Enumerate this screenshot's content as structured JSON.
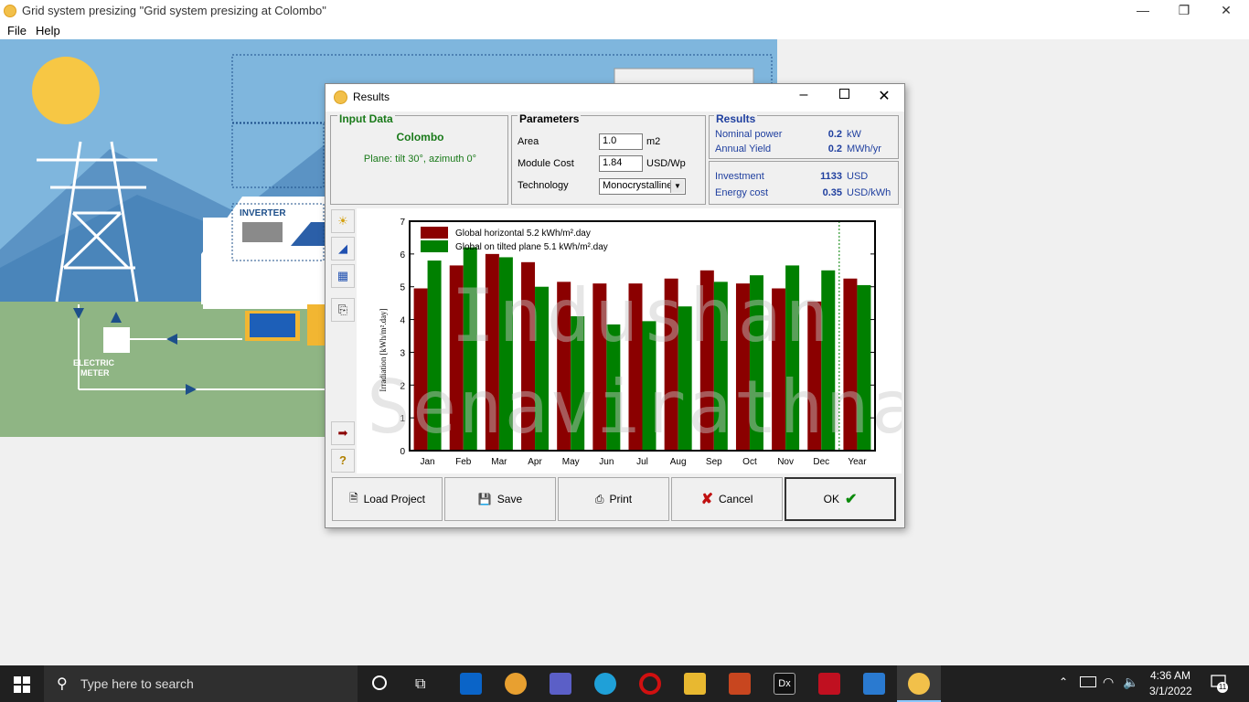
{
  "window": {
    "title": "Grid system presizing  \"Grid system presizing  at Colombo\"",
    "minimize": "—",
    "restore": "❐",
    "close": "✕"
  },
  "menu": {
    "items": [
      "File",
      "Help"
    ]
  },
  "scene": {
    "inverter_label": "INVERTER",
    "meter_label_1": "ELECTRIC",
    "meter_label_2": "METER"
  },
  "dialog": {
    "title": "Results",
    "input_data": {
      "header": "Input Data",
      "location": "Colombo",
      "plane": "Plane: tilt 30°, azimuth 0°"
    },
    "parameters": {
      "header": "Parameters",
      "area_label": "Area",
      "area_value": "1.0",
      "area_unit": "m2",
      "module_cost_label": "Module Cost",
      "module_cost_value": "1.84",
      "module_cost_unit": "USD/Wp",
      "technology_label": "Technology",
      "technology_value": "Monocrystalline"
    },
    "results": {
      "header": "Results",
      "nominal_power_label": "Nominal power",
      "nominal_power_value": "0.2",
      "nominal_power_unit": "kW",
      "annual_yield_label": "Annual Yield",
      "annual_yield_value": "0.2",
      "annual_yield_unit": "MWh/yr",
      "investment_label": "Investment",
      "investment_value": "1133",
      "investment_unit": "USD",
      "energy_cost_label": "Energy cost",
      "energy_cost_value": "0.35",
      "energy_cost_unit": "USD/kWh"
    },
    "side_tools": [
      "sun-chart-icon",
      "tilt-chart-icon",
      "table-icon",
      "export-icon",
      "arrow-icon",
      "help-icon"
    ],
    "buttons": {
      "load": "Load Project",
      "save": "Save",
      "print": "Print",
      "cancel": "Cancel",
      "ok": "OK"
    },
    "watermark_line1": "Indushan",
    "watermark_line2": "Senavirathna"
  },
  "chart_data": {
    "type": "bar",
    "categories": [
      "Jan",
      "Feb",
      "Mar",
      "Apr",
      "May",
      "Jun",
      "Jul",
      "Aug",
      "Sep",
      "Oct",
      "Nov",
      "Dec",
      "Year"
    ],
    "series": [
      {
        "name": "Global horizontal   5.2 kWh/m².day",
        "color": "#8b0000",
        "values": [
          4.95,
          5.65,
          6.0,
          5.75,
          5.15,
          5.1,
          5.1,
          5.25,
          5.5,
          5.1,
          4.95,
          4.55,
          5.25
        ]
      },
      {
        "name": "Global on tilted plane   5.1 kWh/m².day",
        "color": "#008000",
        "values": [
          5.8,
          6.2,
          5.9,
          5.0,
          4.1,
          3.85,
          3.95,
          4.4,
          5.15,
          5.35,
          5.65,
          5.5,
          5.05
        ]
      }
    ],
    "ylabel": "Irradiation [kWh/m².day]",
    "xlabel": "",
    "ylim": [
      0,
      7
    ],
    "yticks": [
      "0",
      "1",
      "2",
      "3",
      "4",
      "5",
      "6",
      "7"
    ],
    "legend": "top-left",
    "grid": false
  },
  "taskbar": {
    "search_placeholder": "Type here to search",
    "time": "4:36 AM",
    "date": "3/1/2022",
    "notification_count": "11",
    "colors": {
      "background": "#202020",
      "search": "#2f2f2f"
    }
  }
}
